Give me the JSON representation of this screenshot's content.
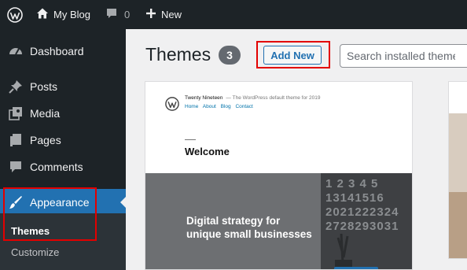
{
  "admin_bar": {
    "site_name": "My Blog",
    "comments_count": "0",
    "new_label": "New"
  },
  "sidebar": {
    "items": [
      {
        "label": "Dashboard",
        "icon": "dashboard-icon"
      },
      {
        "label": "Posts",
        "icon": "pin-icon"
      },
      {
        "label": "Media",
        "icon": "media-icon"
      },
      {
        "label": "Pages",
        "icon": "pages-icon"
      },
      {
        "label": "Comments",
        "icon": "comment-icon"
      },
      {
        "label": "Appearance",
        "icon": "brush-icon",
        "current": true
      }
    ],
    "submenu": [
      {
        "label": "Themes",
        "current": true
      },
      {
        "label": "Customize"
      }
    ]
  },
  "main": {
    "title": "Themes",
    "count": "3",
    "add_new_label": "Add New",
    "search_placeholder": "Search installed themes..."
  },
  "theme_card": {
    "site_title": "Twenty Nineteen",
    "tagline": "— The WordPress default theme for 2019",
    "nav": [
      "Home",
      "About",
      "Blog",
      "Contact"
    ],
    "heading": "Welcome",
    "hero_line1": "Digital strategy for",
    "hero_line2": "unique small businesses",
    "calendar_digits": "1 2 3 4 5\n13141516\n2021222324\n2728293031"
  },
  "colors": {
    "admin_bar": "#1d2327",
    "accent": "#2271b1",
    "highlight_box": "#e30000"
  }
}
